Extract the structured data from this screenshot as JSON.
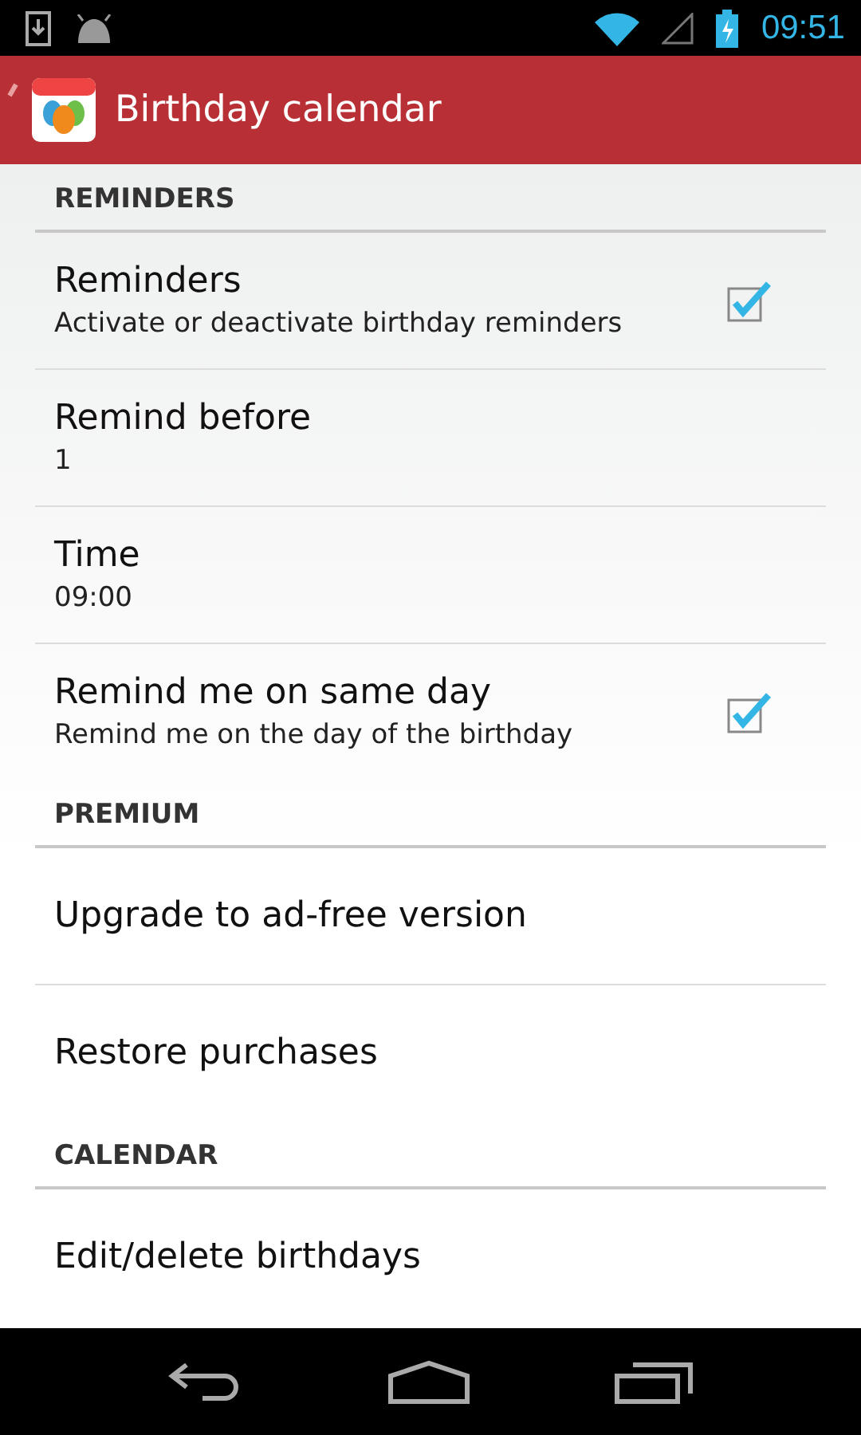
{
  "status_bar": {
    "time": "09:51"
  },
  "action_bar": {
    "title": "Birthday calendar"
  },
  "sections": [
    {
      "title": "REMINDERS",
      "items": [
        {
          "kind": "checkbox",
          "title": "Reminders",
          "summary": "Activate or deactivate birthday reminders",
          "checked": true
        },
        {
          "kind": "plain",
          "title": "Remind before",
          "summary": "1"
        },
        {
          "kind": "plain",
          "title": "Time",
          "summary": "09:00"
        },
        {
          "kind": "checkbox",
          "title": "Remind me on same day",
          "summary": "Remind me on the day of the birthday",
          "checked": true
        }
      ]
    },
    {
      "title": "PREMIUM",
      "items": [
        {
          "kind": "plain",
          "title": "Upgrade to ad-free version"
        },
        {
          "kind": "plain",
          "title": "Restore purchases"
        }
      ]
    },
    {
      "title": "CALENDAR",
      "items": [
        {
          "kind": "plain",
          "title": "Edit/delete birthdays"
        }
      ]
    }
  ]
}
